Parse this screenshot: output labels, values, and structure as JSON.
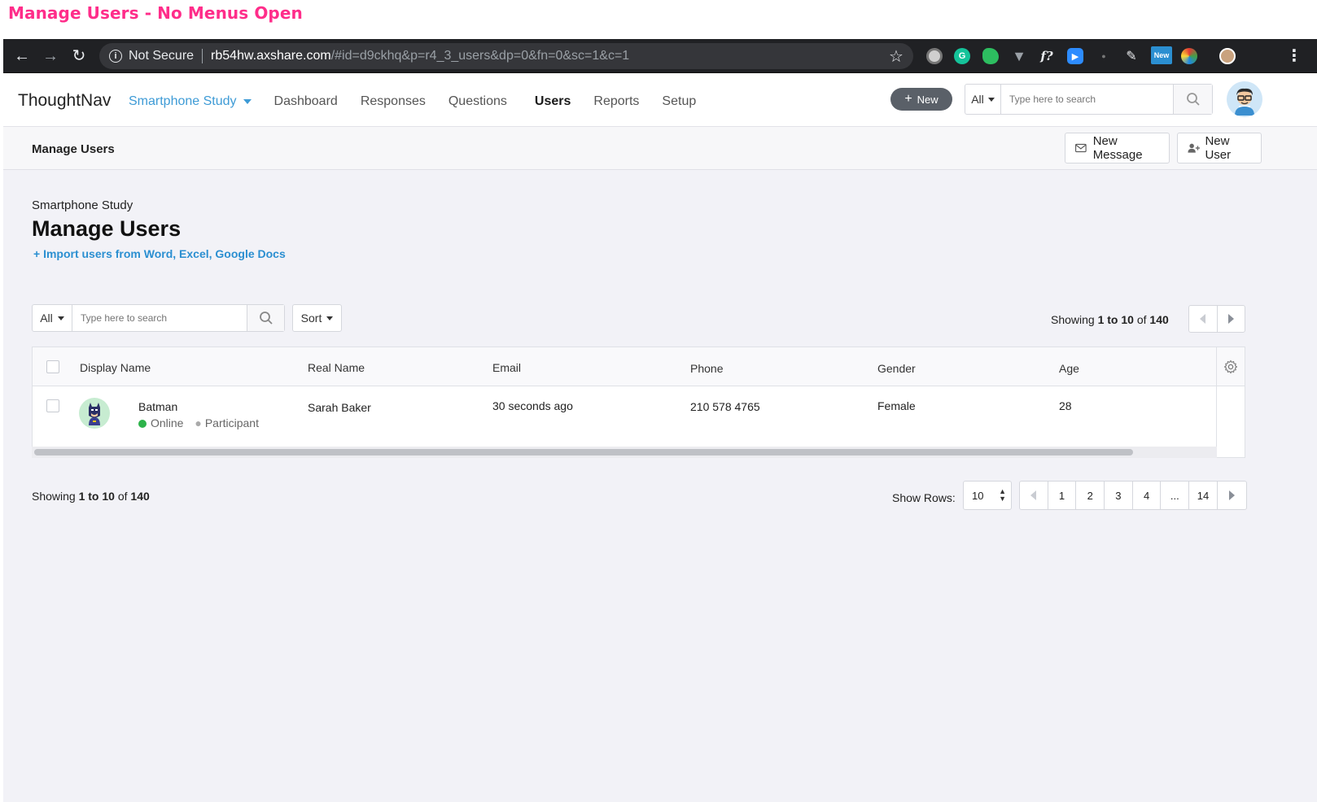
{
  "caption": "Manage Users - No Menus Open",
  "browser": {
    "security_label": "Not Secure",
    "url_host": "rb54hw.axshare.com",
    "url_path": "/#id=d9ckhq&p=r4_3_users&dp=0&fn=0&sc=1&c=1",
    "extension_badge": "New"
  },
  "header": {
    "brand": "ThoughtNav",
    "study": "Smartphone Study",
    "nav": [
      "Dashboard",
      "Responses",
      "Questions",
      "Users",
      "Reports",
      "Setup"
    ],
    "active_nav": "Users",
    "new_button": "New",
    "search_scope": "All",
    "search_placeholder": "Type here to search"
  },
  "subheader": {
    "title": "Manage Users",
    "new_message_button": "New Message",
    "new_user_button": "New User"
  },
  "page": {
    "study_label": "Smartphone Study",
    "heading": "Manage Users",
    "import_link": "+ Import users from Word, Excel, Google Docs"
  },
  "filters": {
    "scope": "All",
    "placeholder": "Type here to search",
    "sort_label": "Sort"
  },
  "showing": {
    "prefix": "Showing",
    "range": "1 to 10",
    "of": "of",
    "total": "140"
  },
  "table": {
    "columns": [
      "Display Name",
      "Real Name",
      "Email",
      "Phone",
      "Gender",
      "Age"
    ],
    "rows": [
      {
        "display_name": "Batman",
        "status": "Online",
        "role": "Participant",
        "real_name": "Sarah Baker",
        "email": "30 seconds ago",
        "phone": "210 578 4765",
        "gender": "Female",
        "age": "28"
      }
    ]
  },
  "pagination": {
    "show_rows_label": "Show Rows:",
    "rows_value": "10",
    "pages": [
      "1",
      "2",
      "3",
      "4",
      "...",
      "14"
    ]
  },
  "colors": {
    "caption": "#ff2d8a",
    "link": "#2b8fd1",
    "online": "#2db34a",
    "chrome_bg": "#202124"
  }
}
